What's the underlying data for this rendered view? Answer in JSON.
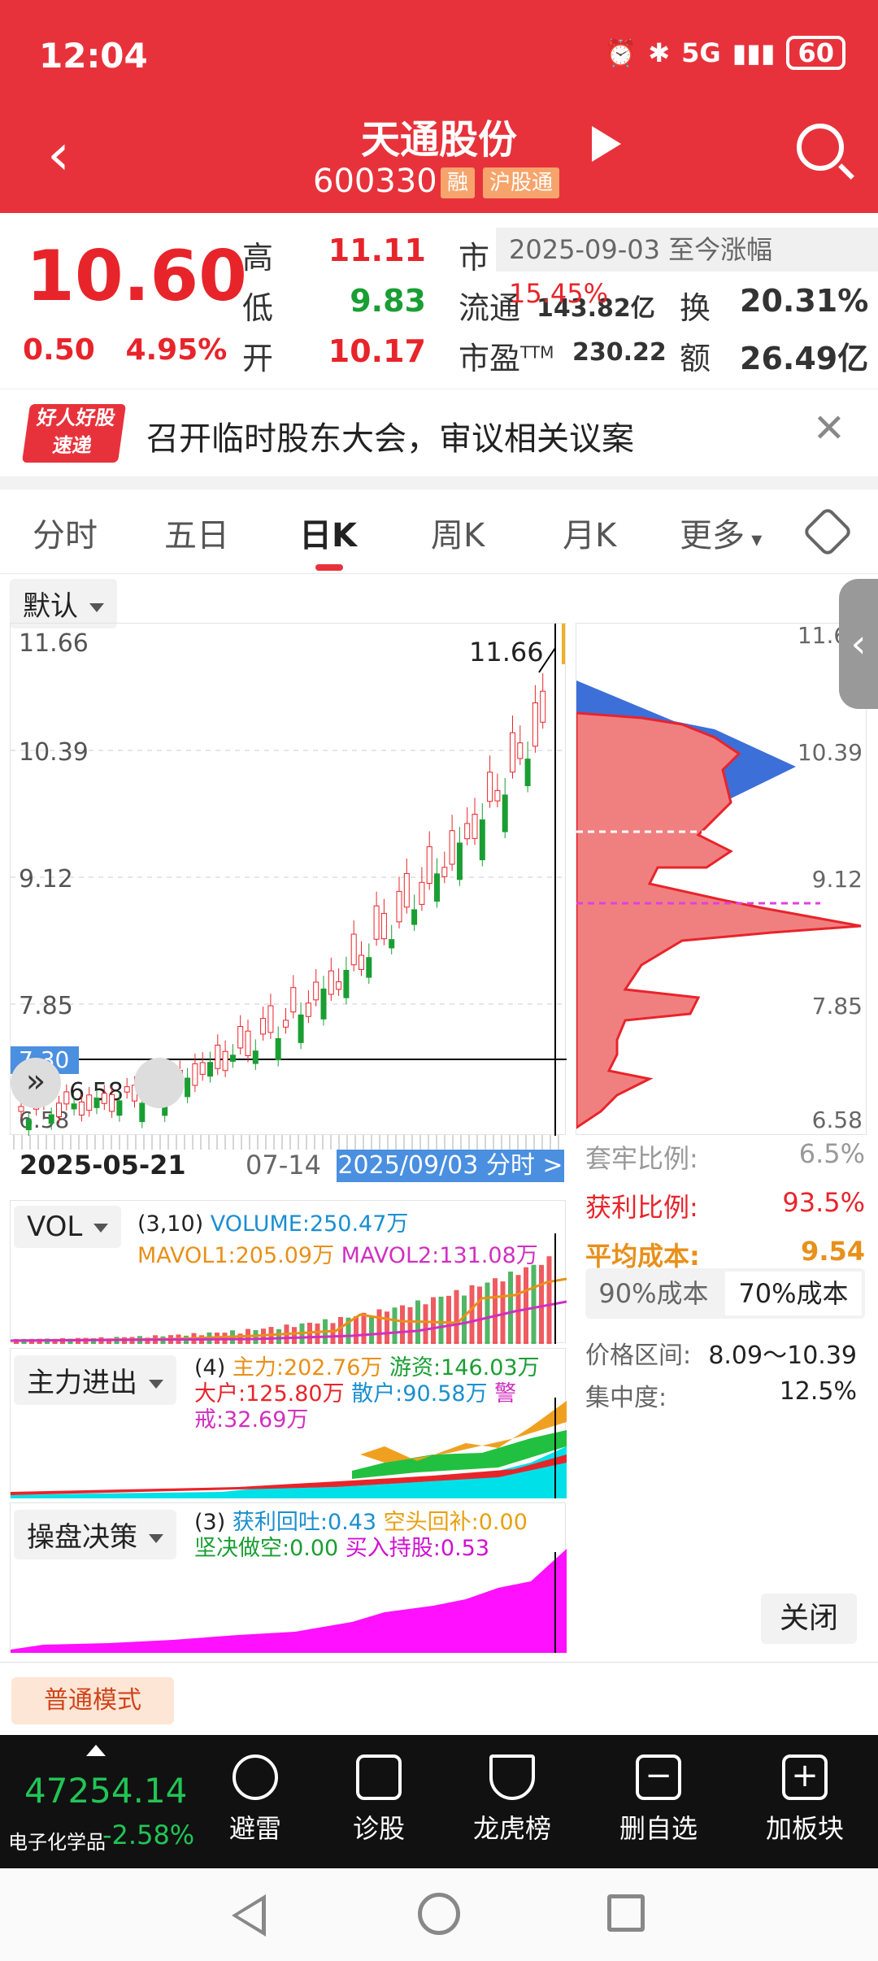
{
  "status": {
    "time": "12:04",
    "battery": "60",
    "signal": "5G"
  },
  "header": {
    "name": "天通股份",
    "code": "600330",
    "tags": [
      "融",
      "沪股通"
    ]
  },
  "quote": {
    "price": "10.60",
    "change": "0.50",
    "change_pct": "4.95%",
    "labels": {
      "high": "高",
      "low": "低",
      "open": "开",
      "float": "流通",
      "pe": "市盈",
      "pe_sup": "TTM",
      "turnover": "换",
      "amount": "额",
      "mcap": "市"
    },
    "high": "11.11",
    "low": "9.83",
    "open": "10.17",
    "float_value": "143.82亿",
    "pe_value": "230.22",
    "turnover_value": "20.31%",
    "amount_value": "26.49亿",
    "tip_text": "2025-09-03 至今涨幅",
    "tip_value": "15.45%"
  },
  "news": {
    "logo": "好人好股 速递",
    "text": "召开临时股东大会，审议相关议案"
  },
  "tabs": [
    "分时",
    "五日",
    "日K",
    "周K",
    "月K",
    "更多"
  ],
  "chart": {
    "default_label": "默认",
    "price_ticks": [
      "11.66",
      "10.39",
      "9.12",
      "7.85",
      "7.30",
      "6.58"
    ],
    "high_marker": "11.66",
    "low_marker": "6.58",
    "date_start": "2025-05-21",
    "date_mid": "07-14",
    "date_select": "2025/09/03 分时 >"
  },
  "chip": {
    "ticks": [
      "11.66",
      "10.39",
      "9.12",
      "7.85",
      "6.58"
    ],
    "rows": [
      {
        "label": "套牢比例:",
        "value": "6.5%"
      },
      {
        "label": "获利比例:",
        "value": "93.5%"
      },
      {
        "label": "平均成本:",
        "value": "9.54"
      }
    ],
    "toggle": [
      "90%成本",
      "70%成本"
    ],
    "range_label": "价格区间:",
    "range_value": "8.09～10.39",
    "conc_label": "集中度:",
    "conc_value": "12.5%",
    "close": "关闭"
  },
  "vol": {
    "name": "VOL",
    "params": "(3,10)",
    "volume": "VOLUME:250.47万",
    "mavol1": "MAVOL1:205.09万",
    "mavol2": "MAVOL2:131.08万"
  },
  "flow": {
    "name": "主力进出",
    "params": "(4)",
    "main": "主力:202.76万",
    "hot": "游资:146.03万",
    "big": "大户:125.80万",
    "retail": "散户:90.58万",
    "alert": "警戒:32.69万"
  },
  "decision": {
    "name": "操盘决策",
    "params": "(3)",
    "a": "获利回吐:0.43",
    "b": "空头回补:0.00",
    "c": "坚决做空:0.00",
    "d": "买入持股:0.53"
  },
  "mode": "普通模式",
  "bottom": {
    "index_value": "47254.14",
    "index_name": "电子化学品",
    "index_chg": "-2.58%",
    "items": [
      "避雷",
      "诊股",
      "龙虎榜",
      "删自选",
      "加板块"
    ]
  },
  "colors": {
    "brand": "#e8323b",
    "up": "#e8242b",
    "down": "#1a9e33",
    "accent": "#4a7fd4"
  }
}
